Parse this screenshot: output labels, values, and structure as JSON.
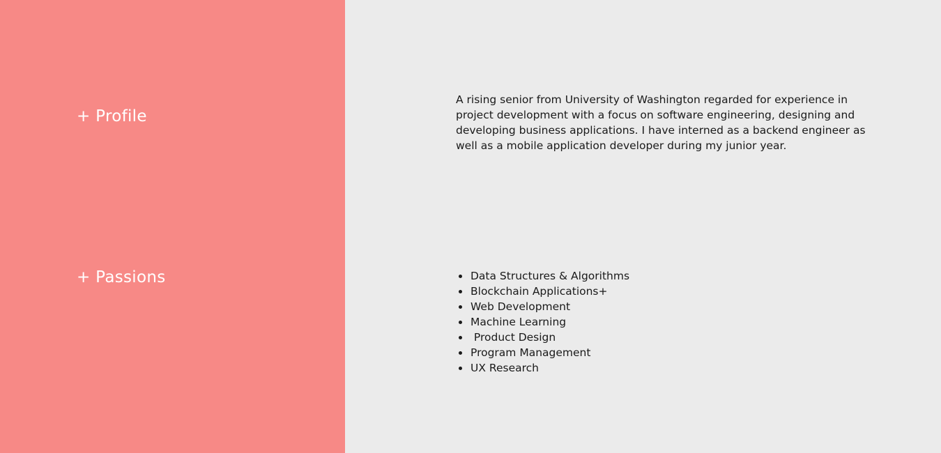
{
  "colors": {
    "left_panel": "#f78986",
    "right_panel": "#ebebeb",
    "heading_text": "#ffffff",
    "body_text": "#1a1a1a"
  },
  "profile": {
    "heading": "+ Profile",
    "text": "A rising senior from University of Washington regarded for experience in project development with a focus on software engineering, designing and developing business applications. I have interned as a backend engineer as well as a mobile application developer during my junior year."
  },
  "passions": {
    "heading": "+ Passions",
    "items": [
      "Data Structures & Algorithms",
      "Blockchain Applications+",
      "Web Development",
      "Machine Learning",
      " Product Design",
      "Program Management",
      "UX Research"
    ]
  }
}
